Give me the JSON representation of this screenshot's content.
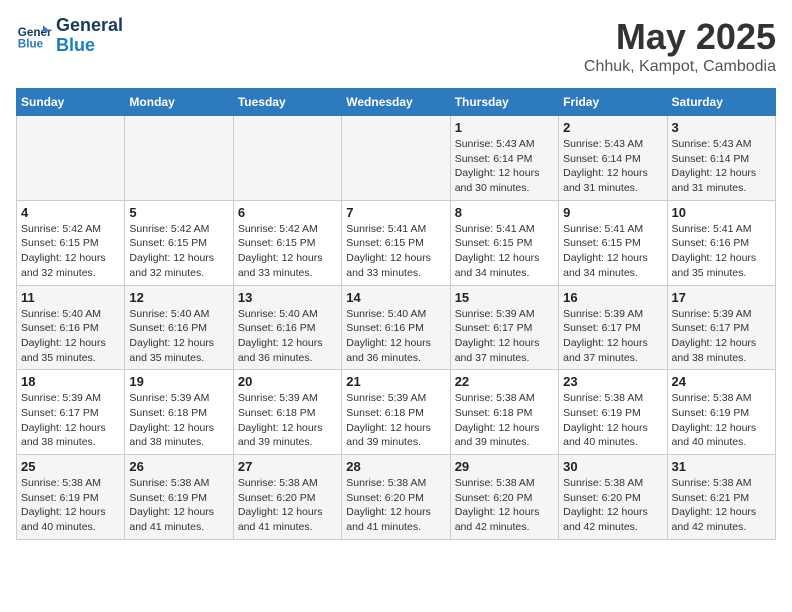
{
  "header": {
    "logo_line1": "General",
    "logo_line2": "Blue",
    "title": "May 2025",
    "subtitle": "Chhuk, Kampot, Cambodia"
  },
  "weekdays": [
    "Sunday",
    "Monday",
    "Tuesday",
    "Wednesday",
    "Thursday",
    "Friday",
    "Saturday"
  ],
  "weeks": [
    [
      {
        "day": "",
        "info": ""
      },
      {
        "day": "",
        "info": ""
      },
      {
        "day": "",
        "info": ""
      },
      {
        "day": "",
        "info": ""
      },
      {
        "day": "1",
        "info": "Sunrise: 5:43 AM\nSunset: 6:14 PM\nDaylight: 12 hours\nand 30 minutes."
      },
      {
        "day": "2",
        "info": "Sunrise: 5:43 AM\nSunset: 6:14 PM\nDaylight: 12 hours\nand 31 minutes."
      },
      {
        "day": "3",
        "info": "Sunrise: 5:43 AM\nSunset: 6:14 PM\nDaylight: 12 hours\nand 31 minutes."
      }
    ],
    [
      {
        "day": "4",
        "info": "Sunrise: 5:42 AM\nSunset: 6:15 PM\nDaylight: 12 hours\nand 32 minutes."
      },
      {
        "day": "5",
        "info": "Sunrise: 5:42 AM\nSunset: 6:15 PM\nDaylight: 12 hours\nand 32 minutes."
      },
      {
        "day": "6",
        "info": "Sunrise: 5:42 AM\nSunset: 6:15 PM\nDaylight: 12 hours\nand 33 minutes."
      },
      {
        "day": "7",
        "info": "Sunrise: 5:41 AM\nSunset: 6:15 PM\nDaylight: 12 hours\nand 33 minutes."
      },
      {
        "day": "8",
        "info": "Sunrise: 5:41 AM\nSunset: 6:15 PM\nDaylight: 12 hours\nand 34 minutes."
      },
      {
        "day": "9",
        "info": "Sunrise: 5:41 AM\nSunset: 6:15 PM\nDaylight: 12 hours\nand 34 minutes."
      },
      {
        "day": "10",
        "info": "Sunrise: 5:41 AM\nSunset: 6:16 PM\nDaylight: 12 hours\nand 35 minutes."
      }
    ],
    [
      {
        "day": "11",
        "info": "Sunrise: 5:40 AM\nSunset: 6:16 PM\nDaylight: 12 hours\nand 35 minutes."
      },
      {
        "day": "12",
        "info": "Sunrise: 5:40 AM\nSunset: 6:16 PM\nDaylight: 12 hours\nand 35 minutes."
      },
      {
        "day": "13",
        "info": "Sunrise: 5:40 AM\nSunset: 6:16 PM\nDaylight: 12 hours\nand 36 minutes."
      },
      {
        "day": "14",
        "info": "Sunrise: 5:40 AM\nSunset: 6:16 PM\nDaylight: 12 hours\nand 36 minutes."
      },
      {
        "day": "15",
        "info": "Sunrise: 5:39 AM\nSunset: 6:17 PM\nDaylight: 12 hours\nand 37 minutes."
      },
      {
        "day": "16",
        "info": "Sunrise: 5:39 AM\nSunset: 6:17 PM\nDaylight: 12 hours\nand 37 minutes."
      },
      {
        "day": "17",
        "info": "Sunrise: 5:39 AM\nSunset: 6:17 PM\nDaylight: 12 hours\nand 38 minutes."
      }
    ],
    [
      {
        "day": "18",
        "info": "Sunrise: 5:39 AM\nSunset: 6:17 PM\nDaylight: 12 hours\nand 38 minutes."
      },
      {
        "day": "19",
        "info": "Sunrise: 5:39 AM\nSunset: 6:18 PM\nDaylight: 12 hours\nand 38 minutes."
      },
      {
        "day": "20",
        "info": "Sunrise: 5:39 AM\nSunset: 6:18 PM\nDaylight: 12 hours\nand 39 minutes."
      },
      {
        "day": "21",
        "info": "Sunrise: 5:39 AM\nSunset: 6:18 PM\nDaylight: 12 hours\nand 39 minutes."
      },
      {
        "day": "22",
        "info": "Sunrise: 5:38 AM\nSunset: 6:18 PM\nDaylight: 12 hours\nand 39 minutes."
      },
      {
        "day": "23",
        "info": "Sunrise: 5:38 AM\nSunset: 6:19 PM\nDaylight: 12 hours\nand 40 minutes."
      },
      {
        "day": "24",
        "info": "Sunrise: 5:38 AM\nSunset: 6:19 PM\nDaylight: 12 hours\nand 40 minutes."
      }
    ],
    [
      {
        "day": "25",
        "info": "Sunrise: 5:38 AM\nSunset: 6:19 PM\nDaylight: 12 hours\nand 40 minutes."
      },
      {
        "day": "26",
        "info": "Sunrise: 5:38 AM\nSunset: 6:19 PM\nDaylight: 12 hours\nand 41 minutes."
      },
      {
        "day": "27",
        "info": "Sunrise: 5:38 AM\nSunset: 6:20 PM\nDaylight: 12 hours\nand 41 minutes."
      },
      {
        "day": "28",
        "info": "Sunrise: 5:38 AM\nSunset: 6:20 PM\nDaylight: 12 hours\nand 41 minutes."
      },
      {
        "day": "29",
        "info": "Sunrise: 5:38 AM\nSunset: 6:20 PM\nDaylight: 12 hours\nand 42 minutes."
      },
      {
        "day": "30",
        "info": "Sunrise: 5:38 AM\nSunset: 6:20 PM\nDaylight: 12 hours\nand 42 minutes."
      },
      {
        "day": "31",
        "info": "Sunrise: 5:38 AM\nSunset: 6:21 PM\nDaylight: 12 hours\nand 42 minutes."
      }
    ]
  ]
}
